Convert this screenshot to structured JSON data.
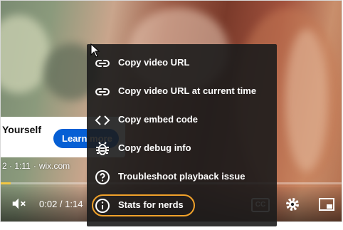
{
  "ad": {
    "title": "Yourself",
    "button_label": "Learn more",
    "progress_time": "2 · 1:11",
    "site": "wix.com"
  },
  "player": {
    "time": "0:02 / 1:14",
    "progress_fraction": 0.03,
    "cc_label": "CC"
  },
  "context_menu": {
    "items": [
      {
        "label": "Copy video URL",
        "icon": "link-icon"
      },
      {
        "label": "Copy video URL at current time",
        "icon": "link-icon"
      },
      {
        "label": "Copy embed code",
        "icon": "code-icon"
      },
      {
        "label": "Copy debug info",
        "icon": "bug-icon"
      },
      {
        "label": "Troubleshoot playback issue",
        "icon": "help-icon"
      },
      {
        "label": "Stats for nerds",
        "icon": "info-icon"
      }
    ],
    "highlighted": "Stats for nerds"
  },
  "colors": {
    "highlight_ring": "#f0a12a",
    "progress": "#f2c744",
    "ad_button": "#065fd4"
  }
}
